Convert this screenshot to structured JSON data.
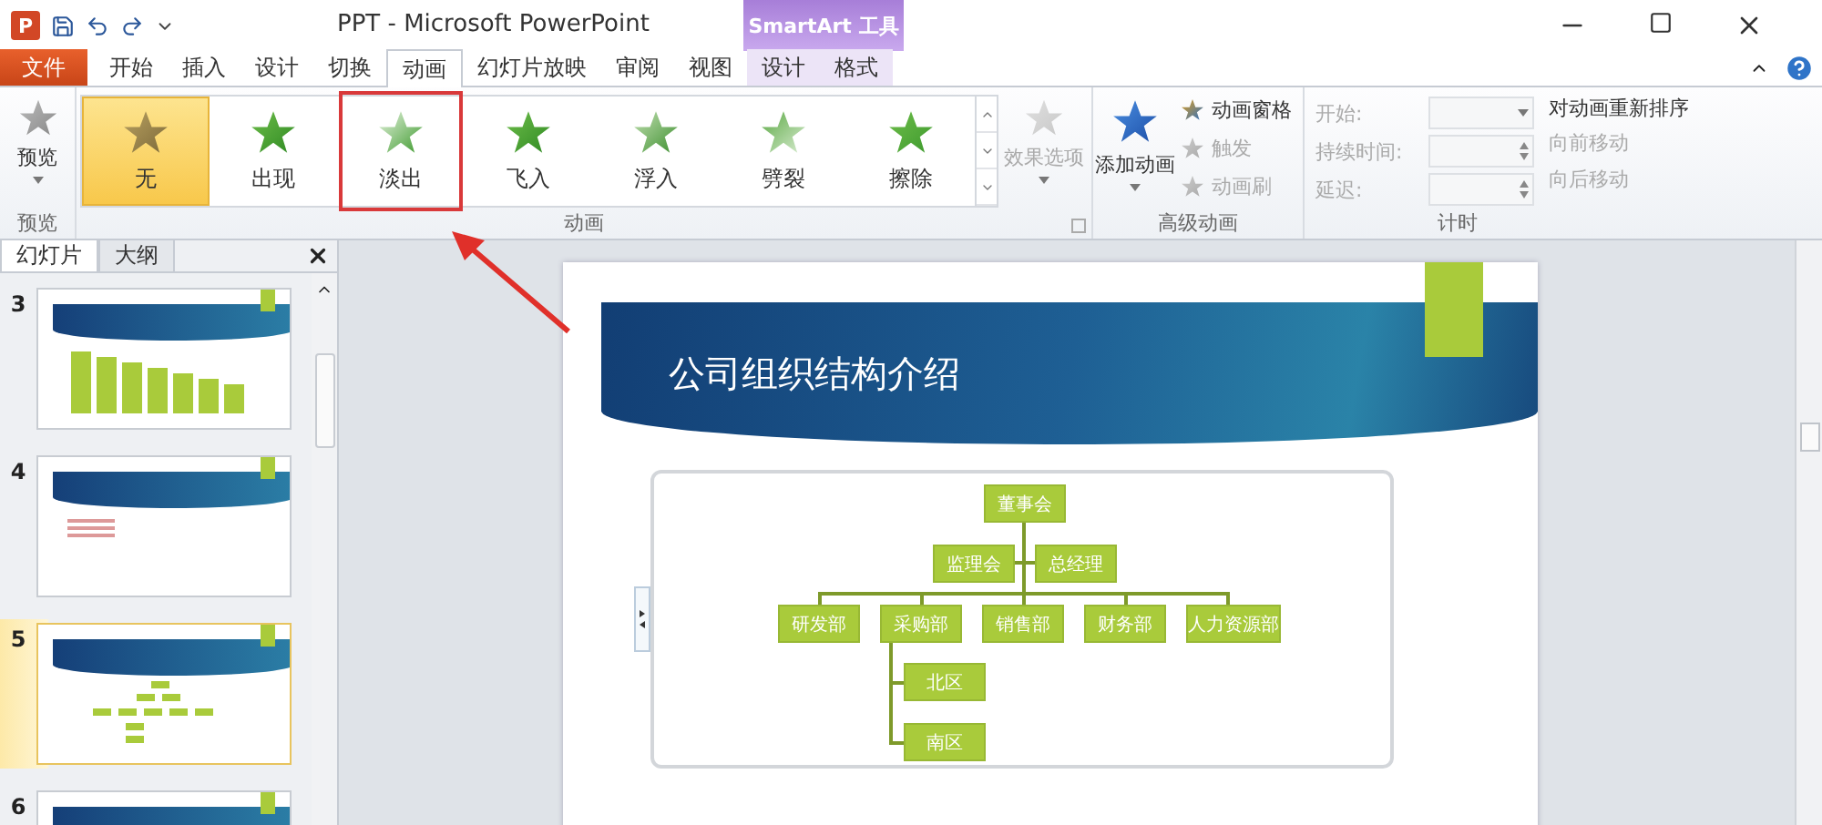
{
  "window": {
    "app_icon": "P",
    "title": "PPT - Microsoft PowerPoint",
    "context_label": "SmartArt 工具"
  },
  "tabs": [
    {
      "label": "文件",
      "kind": "file",
      "selected": false
    },
    {
      "label": "开始",
      "kind": "normal",
      "selected": false
    },
    {
      "label": "插入",
      "kind": "normal",
      "selected": false
    },
    {
      "label": "设计",
      "kind": "normal",
      "selected": false
    },
    {
      "label": "切换",
      "kind": "normal",
      "selected": false
    },
    {
      "label": "动画",
      "kind": "normal",
      "selected": true
    },
    {
      "label": "幻灯片放映",
      "kind": "normal",
      "selected": false
    },
    {
      "label": "审阅",
      "kind": "normal",
      "selected": false
    },
    {
      "label": "视图",
      "kind": "normal",
      "selected": false
    },
    {
      "label": "设计",
      "kind": "contextual",
      "selected": false
    },
    {
      "label": "格式",
      "kind": "contextual",
      "selected": false
    }
  ],
  "ribbon": {
    "preview": {
      "button": "预览",
      "group_label": "预览"
    },
    "animations": {
      "items": [
        {
          "label": "无",
          "selected": true,
          "annotated": false
        },
        {
          "label": "出现",
          "selected": false,
          "annotated": false
        },
        {
          "label": "淡出",
          "selected": false,
          "annotated": true
        },
        {
          "label": "飞入",
          "selected": false,
          "annotated": false
        },
        {
          "label": "浮入",
          "selected": false,
          "annotated": false
        },
        {
          "label": "劈裂",
          "selected": false,
          "annotated": false
        },
        {
          "label": "擦除",
          "selected": false,
          "annotated": false
        }
      ],
      "effect_options": {
        "label": "效果选项",
        "disabled": true
      },
      "group_label": "动画"
    },
    "advanced": {
      "add_button": "添加动画",
      "commands": [
        {
          "label": "动画窗格",
          "disabled": false
        },
        {
          "label": "触发",
          "disabled": true
        },
        {
          "label": "动画刷",
          "disabled": true
        }
      ],
      "group_label": "高级动画"
    },
    "timing": {
      "fields": [
        {
          "label": "开始:",
          "kind": "dropdown",
          "disabled": true
        },
        {
          "label": "持续时间:",
          "kind": "spinner",
          "disabled": true
        },
        {
          "label": "延迟:",
          "kind": "spinner",
          "disabled": true
        }
      ],
      "reorder_title": "对动画重新排序",
      "reorder": [
        {
          "label": "向前移动",
          "disabled": true
        },
        {
          "label": "向后移动",
          "disabled": true
        }
      ],
      "group_label": "计时"
    }
  },
  "slides_pane": {
    "tabs": [
      {
        "label": "幻灯片",
        "selected": true
      },
      {
        "label": "大纲",
        "selected": false
      }
    ],
    "slides": [
      {
        "number": "3",
        "kind": "bars",
        "selected": false
      },
      {
        "number": "4",
        "kind": "bullets",
        "selected": false
      },
      {
        "number": "5",
        "kind": "orgchart",
        "selected": true
      },
      {
        "number": "6",
        "kind": "title",
        "selected": false
      }
    ]
  },
  "slide": {
    "title": "公司组织结构介绍",
    "org_chart": {
      "root": "董事会",
      "assistants": [
        "监理会",
        "总经理"
      ],
      "departments": [
        {
          "name": "研发部"
        },
        {
          "name": "采购部",
          "children": [
            "北区",
            "南区"
          ]
        },
        {
          "name": "销售部"
        },
        {
          "name": "财务部"
        },
        {
          "name": "人力资源部"
        }
      ]
    }
  }
}
